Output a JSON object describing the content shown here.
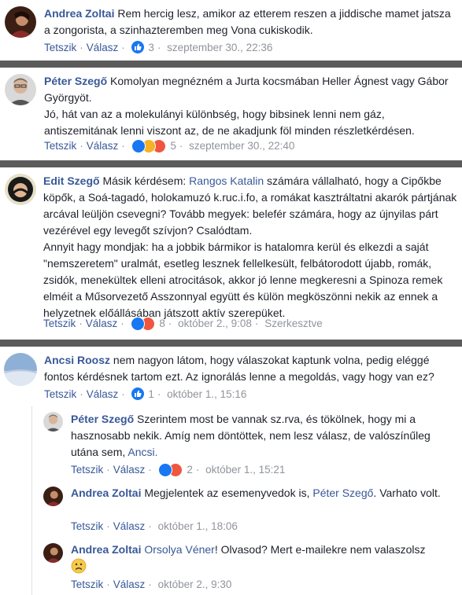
{
  "comments": [
    {
      "name": "Andrea Zoltai",
      "text": "Rem hercig lesz, amikor az etterem reszen a jiddische mamet jatsza a zongorista, a szinhazteremben meg Vona cukiskodik.",
      "like": "Tetszik",
      "reply": "Válasz",
      "reactions": "like",
      "count": "3",
      "time": "szeptember 30., 22:36"
    },
    {
      "name": "Péter Szegő",
      "text1": "Komolyan megnézném a Jurta kocsmában Heller Ágnest vagy Gábor Györgyöt.",
      "text2": "Jó, hát van az a molekulányi különbség, hogy bibsinek lenni nem gáz, antiszemitának lenni viszont az, de ne akadjunk föl minden részletkérdésen.",
      "like": "Tetszik",
      "reply": "Válasz",
      "reactions": "like,haha,angry",
      "count": "5",
      "time": "szeptember 30., 22:40"
    },
    {
      "name": "Edit Szegő",
      "text_a": "Másik kérdésem:",
      "mention": "Rangos Katalin",
      "text_b": "számára vállalható, hogy a Cipőkbe köpők, a Soá-tagadó, holokamuzó k.ruc.i.fo, a romákat kasztráltatni akarók pártjának arcával leüljön csevegni? Tovább megyek: belefér számára, hogy az újnyilas párt vezérével egy levegőt szívjon? Csalódtam.",
      "text_c": "Annyit hagy mondjak: ha a jobbik bármikor is hatalomra kerül és elkezdi a saját \"nemszeretem\" uralmát, esetleg lesznek fellelkesült, felbátorodott újabb, romák, zsidók, menekültek elleni atrocitások, akkor jó lenne megkeresni a Spinoza remek elméit a Műsorvezető Asszonnyal együtt és külön megköszönni nekik az ennek a helyzetnek előállásában játszott aktív szerepüket.",
      "like": "Tetszik",
      "reply": "Válasz",
      "reactions": "like,angry",
      "count": "8",
      "time": "október 2., 9:08",
      "edited": "Szerkesztve"
    },
    {
      "name": "Ancsi Roosz",
      "text": "nem nagyon látom, hogy válaszokat kaptunk volna, pedig eléggé fontos kérdésnek tartom ezt. Az ignorálás lenne a megoldás, vagy hogy van ez?",
      "like": "Tetszik",
      "reply": "Válasz",
      "reactions": "like",
      "count": "1",
      "time": "október 1., 15:16"
    }
  ],
  "replies": [
    {
      "name": "Péter Szegő",
      "text": "Szerintem most be vannak sz.rva, és tökölnek, hogy mi a hasznosabb nekik. Amíg nem döntöttek, nem lesz válasz, de valószínűleg utána sem,",
      "mention": "Ancsi.",
      "like": "Tetszik",
      "reply": "Válasz",
      "reactions": "like,angry",
      "count": "2",
      "time": "október 1., 15:21"
    },
    {
      "name": "Andrea Zoltai",
      "text_a": "Megjelentek az esemenyvedok is,",
      "mention": "Péter Szegő",
      "text_b": ". Varhato volt.",
      "like": "Tetszik",
      "reply": "Válasz",
      "time": "október 1., 18:06"
    },
    {
      "name": "Andrea Zoltai",
      "mention": "Orsolya Véner",
      "text": "! Olvasod? Mert e-mailekre nem valaszolsz",
      "like": "Tetszik",
      "reply": "Válasz",
      "time": "október 2., 9:30"
    }
  ],
  "colors": {
    "link": "#385898",
    "meta": "#90949c",
    "separator": "#5b5b5b",
    "like": "#1877f2",
    "angry": "#f0563f",
    "haha": "#f7b125"
  }
}
